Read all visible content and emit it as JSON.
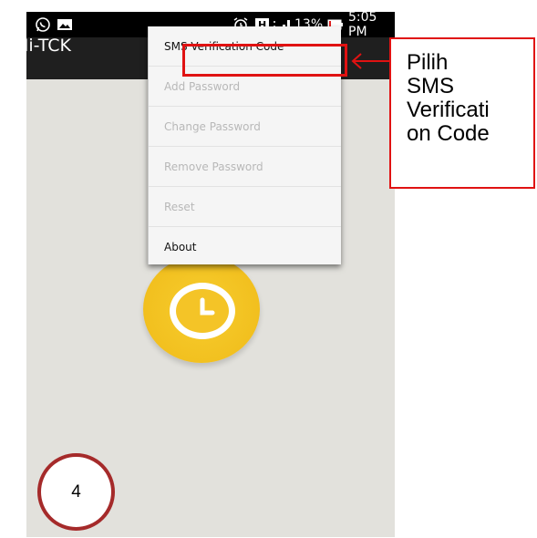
{
  "status_bar": {
    "battery_percent": "13%",
    "time": "5:05 PM",
    "network": "H"
  },
  "app": {
    "title": "Mi-TCK"
  },
  "overflow_menu": {
    "items": [
      {
        "label": "SMS Verification Code",
        "enabled": true
      },
      {
        "label": "Add Password",
        "enabled": false
      },
      {
        "label": "Change Password",
        "enabled": false
      },
      {
        "label": "Remove Password",
        "enabled": false
      },
      {
        "label": "Reset",
        "enabled": false
      },
      {
        "label": "About",
        "enabled": true
      }
    ]
  },
  "callout": {
    "text": "Pilih\nSMS\nVerificati\non Code"
  },
  "step": {
    "number": "4"
  },
  "colors": {
    "annotation_red": "#e01212",
    "step_circle_border": "#a52a2a",
    "clock_yellow": "#f2c01f",
    "background": "#e2e1dc",
    "action_bar": "#1f1f1f"
  },
  "icons": [
    "whatsapp-icon",
    "image-icon",
    "alarm-icon",
    "signal-icon",
    "battery-icon",
    "clock-icon"
  ]
}
